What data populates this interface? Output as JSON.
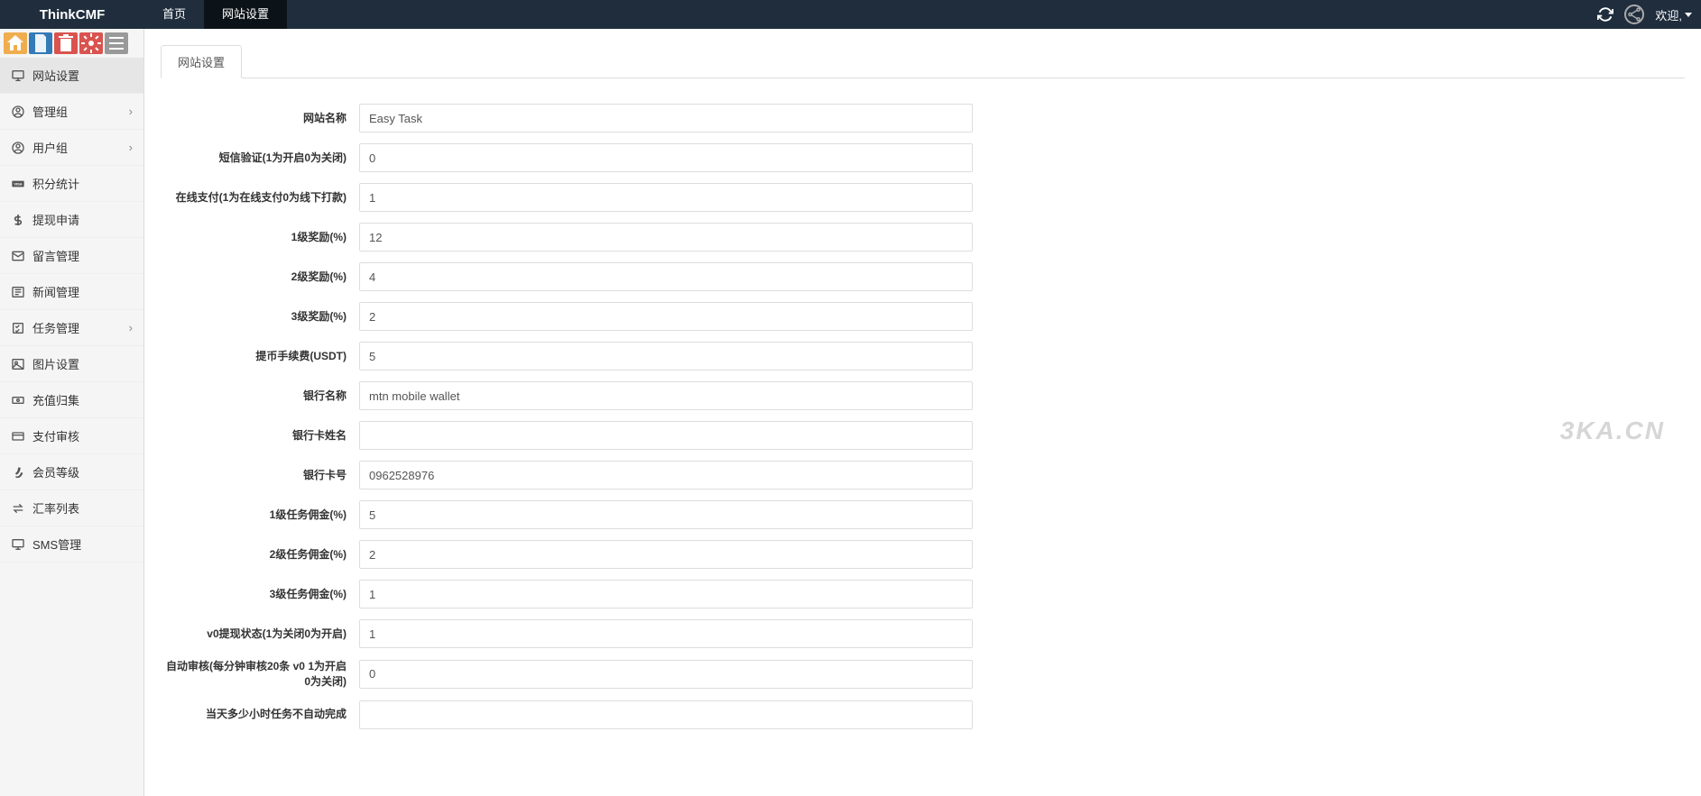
{
  "topbar": {
    "brand": "ThinkCMF",
    "nav": [
      {
        "label": "首页",
        "active": false
      },
      {
        "label": "网站设置",
        "active": true
      }
    ],
    "welcome": "欢迎,"
  },
  "sidebar": {
    "items": [
      {
        "icon": "monitor",
        "label": "网站设置",
        "chevron": false,
        "active": true
      },
      {
        "icon": "user-circle",
        "label": "管理组",
        "chevron": true
      },
      {
        "icon": "user-circle",
        "label": "用户组",
        "chevron": true
      },
      {
        "icon": "visa",
        "label": "积分统计",
        "chevron": false
      },
      {
        "icon": "dollar",
        "label": "提现申请",
        "chevron": false
      },
      {
        "icon": "envelope",
        "label": "留言管理",
        "chevron": false
      },
      {
        "icon": "news",
        "label": "新闻管理",
        "chevron": false
      },
      {
        "icon": "tasks",
        "label": "任务管理",
        "chevron": true
      },
      {
        "icon": "image",
        "label": "图片设置",
        "chevron": false
      },
      {
        "icon": "money",
        "label": "充值归集",
        "chevron": false
      },
      {
        "icon": "card",
        "label": "支付审核",
        "chevron": false
      },
      {
        "icon": "vine",
        "label": "会员等级",
        "chevron": false
      },
      {
        "icon": "exchange",
        "label": "汇率列表",
        "chevron": false
      },
      {
        "icon": "monitor",
        "label": "SMS管理",
        "chevron": false
      }
    ]
  },
  "content": {
    "tab": "网站设置",
    "fields": [
      {
        "label": "网站名称",
        "value": "Easy Task"
      },
      {
        "label": "短信验证(1为开启0为关闭)",
        "value": "0"
      },
      {
        "label": "在线支付(1为在线支付0为线下打款)",
        "value": "1"
      },
      {
        "label": "1级奖励(%)",
        "value": "12"
      },
      {
        "label": "2级奖励(%)",
        "value": "4"
      },
      {
        "label": "3级奖励(%)",
        "value": "2"
      },
      {
        "label": "提币手续费(USDT)",
        "value": "5"
      },
      {
        "label": "银行名称",
        "value": "mtn mobile wallet"
      },
      {
        "label": "银行卡姓名",
        "value": ""
      },
      {
        "label": "银行卡号",
        "value": "0962528976"
      },
      {
        "label": "1级任务佣金(%)",
        "value": "5"
      },
      {
        "label": "2级任务佣金(%)",
        "value": "2"
      },
      {
        "label": "3级任务佣金(%)",
        "value": "1"
      },
      {
        "label": "v0提现状态(1为关闭0为开启)",
        "value": "1"
      },
      {
        "label": "自动审核(每分钟审核20条 v0 1为开启 0为关闭)",
        "value": "0"
      },
      {
        "label": "当天多少小时任务不自动完成",
        "value": ""
      }
    ]
  },
  "watermark": "3KA.CN"
}
